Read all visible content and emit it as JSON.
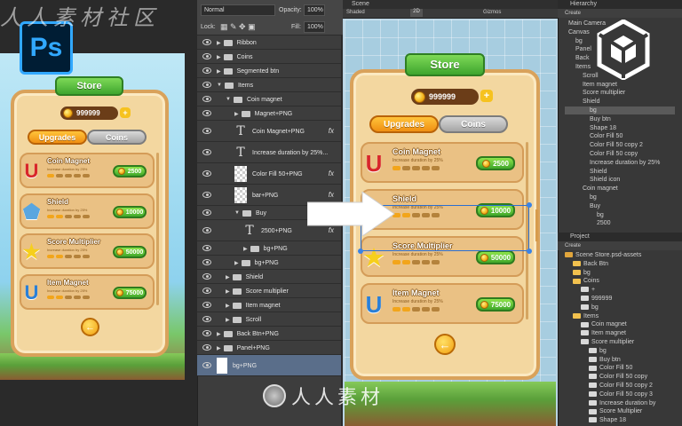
{
  "watermark_top": "人人素材社区",
  "watermark_bottom": "人人素材",
  "photoshop": {
    "logo": "Ps",
    "blend_mode": "Normal",
    "opacity_label": "Opacity:",
    "opacity_value": "100%",
    "lock_label": "Lock:",
    "fill_label": "Fill:",
    "fill_value": "100%",
    "layers": [
      {
        "label": "Ribbon",
        "indent": 0,
        "kind": "folder"
      },
      {
        "label": "Coins",
        "indent": 0,
        "kind": "folder"
      },
      {
        "label": "Segmented btn",
        "indent": 0,
        "kind": "folder"
      },
      {
        "label": "Items",
        "indent": 0,
        "kind": "folder-open"
      },
      {
        "label": "Coin magnet",
        "indent": 1,
        "kind": "folder-open"
      },
      {
        "label": "Magnet+PNG",
        "indent": 2,
        "kind": "folder"
      },
      {
        "label": "Coin Magnet+PNG",
        "indent": 2,
        "kind": "text",
        "fx": "fx"
      },
      {
        "label": "Increase duration by 25%...",
        "indent": 2,
        "kind": "text"
      },
      {
        "label": "Color Fill 50+PNG",
        "indent": 2,
        "kind": "thumb",
        "fx": "fx"
      },
      {
        "label": "bar+PNG",
        "indent": 2,
        "kind": "thumb",
        "fx": "fx"
      },
      {
        "label": "Buy",
        "indent": 2,
        "kind": "folder-open"
      },
      {
        "label": "2500+PNG",
        "indent": 3,
        "kind": "text",
        "fx": "fx"
      },
      {
        "label": "bg+PNG",
        "indent": 3,
        "kind": "folder"
      },
      {
        "label": "bg+PNG",
        "indent": 2,
        "kind": "folder"
      },
      {
        "label": "Shield",
        "indent": 1,
        "kind": "folder"
      },
      {
        "label": "Score multiplier",
        "indent": 1,
        "kind": "folder"
      },
      {
        "label": "Item magnet",
        "indent": 1,
        "kind": "folder"
      },
      {
        "label": "Scroll",
        "indent": 1,
        "kind": "folder"
      },
      {
        "label": "Back Btn+PNG",
        "indent": 0,
        "kind": "folder"
      },
      {
        "label": "Panel+PNG",
        "indent": 0,
        "kind": "folder"
      },
      {
        "label": "bg+PNG",
        "indent": 0,
        "kind": "thumb-selected"
      }
    ]
  },
  "store": {
    "title": "Store",
    "coins": "999999",
    "plus": "+",
    "tab_upgrades": "Upgrades",
    "tab_coins": "Coins",
    "desc": "Increase duration by 25%",
    "back_glyph": "←",
    "items": [
      {
        "name": "Coin Magnet",
        "price": "2500",
        "filled": 1,
        "icon": "magnet-icon",
        "glyph": "U",
        "color": "#d8262a"
      },
      {
        "name": "Shield",
        "price": "10000",
        "filled": 2,
        "icon": "shield-icon",
        "glyph": "⬟",
        "color": "#5aa6e0"
      },
      {
        "name": "Score Multiplier",
        "price": "50000",
        "filled": 2,
        "icon": "star-icon",
        "glyph": "★",
        "color": "#f6cf1c"
      },
      {
        "name": "Item Magnet",
        "price": "75000",
        "filled": 2,
        "icon": "item-magnet-icon",
        "glyph": "U",
        "color": "#2a7fd6"
      }
    ]
  },
  "unity": {
    "scene_tab": "Scene",
    "shaded": "Shaded",
    "mode_2d": "2D",
    "gizmos": "Gizmos",
    "hierarchy_tab": "Hierarchy",
    "create": "Create",
    "hierarchy": [
      {
        "label": "Main Camera",
        "d": 0
      },
      {
        "label": "Canvas",
        "d": 0
      },
      {
        "label": "bg",
        "d": 1
      },
      {
        "label": "Panel",
        "d": 1
      },
      {
        "label": "Back",
        "d": 1
      },
      {
        "label": "Items",
        "d": 1
      },
      {
        "label": "Scroll",
        "d": 2
      },
      {
        "label": "Item magnet",
        "d": 2
      },
      {
        "label": "Score multiplier",
        "d": 2
      },
      {
        "label": "Shield",
        "d": 2
      },
      {
        "label": "bg",
        "d": 3,
        "selected": true
      },
      {
        "label": "Buy btn",
        "d": 3
      },
      {
        "label": "Shape 18",
        "d": 3
      },
      {
        "label": "Color Fill 50",
        "d": 3
      },
      {
        "label": "Color Fill 50 copy 2",
        "d": 3
      },
      {
        "label": "Color Fill 50 copy",
        "d": 3
      },
      {
        "label": "Increase duration by 25%",
        "d": 3
      },
      {
        "label": "Shield",
        "d": 3
      },
      {
        "label": "Shield icon",
        "d": 3
      },
      {
        "label": "Coin magnet",
        "d": 2
      },
      {
        "label": "bg",
        "d": 3
      },
      {
        "label": "Buy",
        "d": 3
      },
      {
        "label": "bg",
        "d": 4
      },
      {
        "label": "2500",
        "d": 4
      }
    ],
    "project_tab": "Project",
    "project": [
      {
        "label": "Scene Store.psd-assets",
        "d": 0
      },
      {
        "label": "Back Btn",
        "d": 1
      },
      {
        "label": "bg",
        "d": 1
      },
      {
        "label": "Coins",
        "d": 1
      },
      {
        "label": "+",
        "d": 2
      },
      {
        "label": "999999",
        "d": 2
      },
      {
        "label": "bg",
        "d": 2
      },
      {
        "label": "Items",
        "d": 1
      },
      {
        "label": "Coin magnet",
        "d": 2
      },
      {
        "label": "Item magnet",
        "d": 2
      },
      {
        "label": "Score multiplier",
        "d": 2
      },
      {
        "label": "bg",
        "d": 3
      },
      {
        "label": "Buy btn",
        "d": 3
      },
      {
        "label": "Color Fill 50",
        "d": 3
      },
      {
        "label": "Color Fill 50 copy",
        "d": 3
      },
      {
        "label": "Color Fill 50 copy 2",
        "d": 3
      },
      {
        "label": "Color Fill 50 copy 3",
        "d": 3
      },
      {
        "label": "Increase duration by",
        "d": 3
      },
      {
        "label": "Score Multiplier",
        "d": 3
      },
      {
        "label": "Shape 18",
        "d": 3
      }
    ]
  }
}
